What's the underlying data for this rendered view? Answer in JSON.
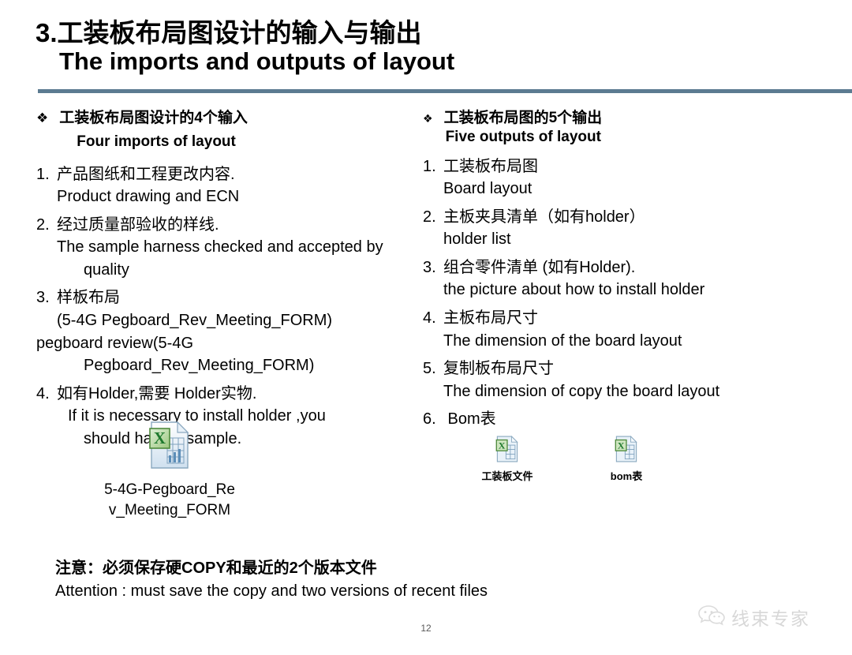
{
  "slide": {
    "title_cn": "3.工装板布局图设计的输入与输出",
    "title_en": "The imports and outputs of layout",
    "page_number": "12",
    "rule_color": "#5c7b91"
  },
  "left_column": {
    "bullet_glyph": "❖",
    "heading_cn": "工装板布局图设计的4个输入",
    "heading_en": "Four imports of layout",
    "items": [
      {
        "num": "1.",
        "cn": "产品图纸和工程更改内容.",
        "en": "Product drawing and ECN"
      },
      {
        "num": "2.",
        "cn": "经过质量部验收的样线.",
        "en": "The sample harness checked and accepted by",
        "en2": "quality"
      },
      {
        "num": "3.",
        "cn": "样板布局",
        "en": "(5-4G Pegboard_Rev_Meeting_FORM)",
        "en_extra1": "pegboard review(5-4G",
        "en_extra2": "Pegboard_Rev_Meeting_FORM)"
      },
      {
        "num": "4.",
        "cn": "如有Holder,需要 Holder实物.",
        "en": "If it is necessary  to install holder ,you",
        "en2": "should have a sample."
      }
    ],
    "file_icon": {
      "icon": "excel-file-icon",
      "caption_line1": "5-4G-Pegboard_Re",
      "caption_line2": "v_Meeting_FORM"
    }
  },
  "right_column": {
    "bullet_glyph": "❖",
    "heading_cn": "工装板布局图的5个输出",
    "heading_en": "Five outputs of layout",
    "items": [
      {
        "num": "1.",
        "cn": "工装板布局图",
        "en": "Board layout"
      },
      {
        "num": "2.",
        "cn": "主板夹具清单（如有holder）",
        "en": "holder list"
      },
      {
        "num": "3.",
        "cn": "组合零件清单 (如有Holder).",
        "en": "the picture about how to install holder"
      },
      {
        "num": "4.",
        "cn": "主板布局尺寸",
        "en": "The dimension of the board layout"
      },
      {
        "num": "5.",
        "cn": "复制板布局尺寸",
        "en": "The dimension of copy the board layout"
      },
      {
        "num": "6.",
        "cn": " Bom表",
        "en": ""
      }
    ],
    "file_icons": [
      {
        "icon": "excel-file-icon",
        "caption": "工装板文件"
      },
      {
        "icon": "excel-file-icon",
        "caption": "bom表"
      }
    ]
  },
  "attention": {
    "cn": "注意：必须保存硬COPY和最近的2个版本文件",
    "en": "Attention : must save the copy and two versions of recent files"
  },
  "watermark": {
    "icon": "wechat-icon",
    "text": "线束专家"
  }
}
